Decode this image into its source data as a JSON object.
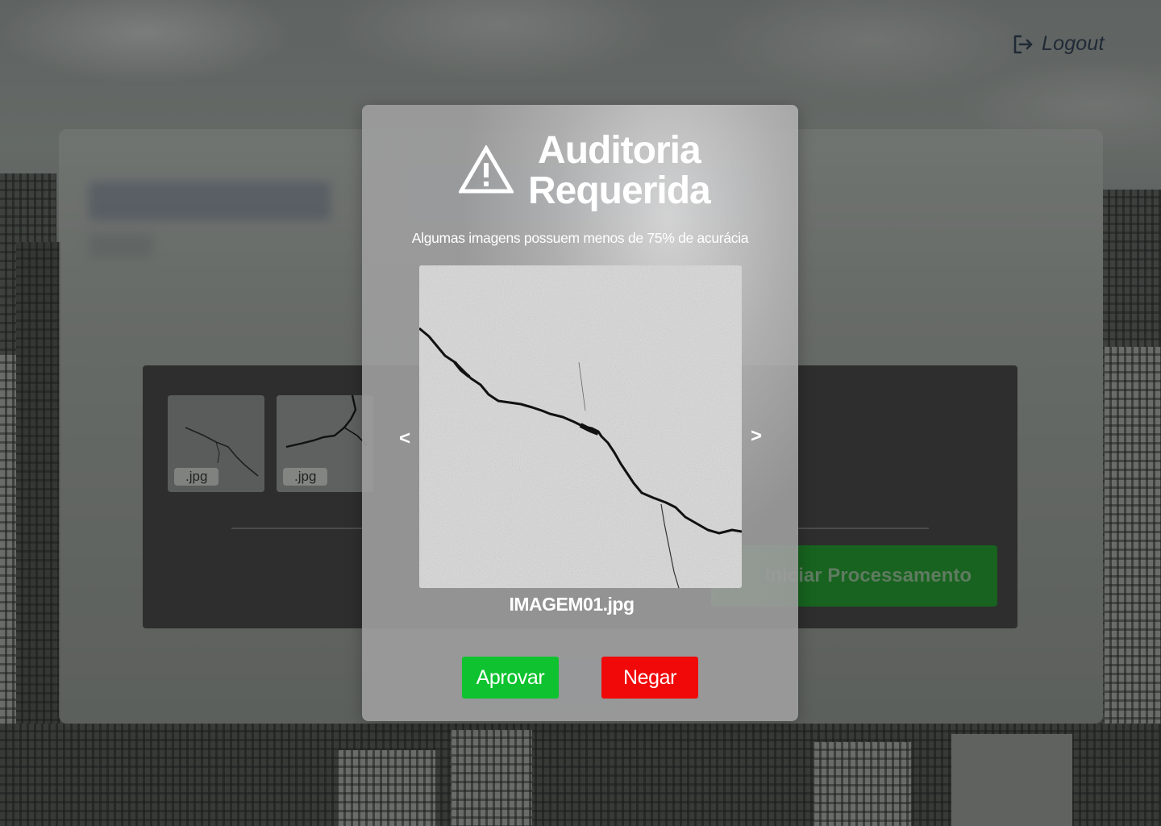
{
  "header": {
    "logout_label": "Logout",
    "logout_icon": "logout-icon"
  },
  "background": {
    "thumbnails": [
      {
        "ext": ".jpg"
      },
      {
        "ext": ".jpg"
      }
    ],
    "start_button_label": "Iniciar Processamento"
  },
  "modal": {
    "icon": "warning-triangle-icon",
    "title_line1": "Auditoria",
    "title_line2": "Requerida",
    "subtitle": "Algumas imagens possuem menos de 75% de acurácia",
    "prev_label": "<",
    "next_label": ">",
    "file_name": "IMAGEM01.jpg",
    "approve_label": "Aprovar",
    "deny_label": "Negar"
  },
  "colors": {
    "approve": "#0ec32f",
    "deny": "#f10808",
    "start_button": "#17631f",
    "logout_text": "#202a36"
  }
}
